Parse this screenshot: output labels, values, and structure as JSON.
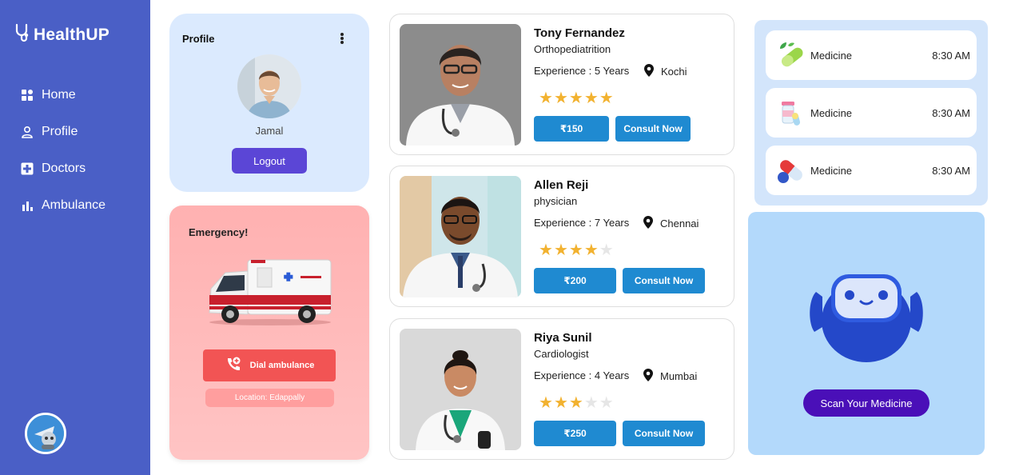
{
  "brand": {
    "name": "HealthUP",
    "icon": "stethoscope-icon"
  },
  "nav": [
    {
      "label": "Home",
      "icon": "home-grid-icon"
    },
    {
      "label": "Profile",
      "icon": "user-icon"
    },
    {
      "label": "Doctors",
      "icon": "medical-cross-icon"
    },
    {
      "label": "Ambulance",
      "icon": "bar-chart-icon"
    }
  ],
  "profile": {
    "title": "Profile",
    "name": "Jamal",
    "logout_label": "Logout"
  },
  "emergency": {
    "title": "Emergency!",
    "dial_label": "Dial ambulance",
    "location": "Location: Edappally"
  },
  "doctors": [
    {
      "name": "Tony Fernandez",
      "specialty": "Orthopediatrition",
      "experience": "Experience : 5 Years",
      "location": "Kochi",
      "rating": 5,
      "price": "₹150",
      "consult_label": "Consult Now"
    },
    {
      "name": "Allen Reji",
      "specialty": "physician",
      "experience": "Experience : 7 Years",
      "location": "Chennai",
      "rating": 4,
      "price": "₹200",
      "consult_label": "Consult Now"
    },
    {
      "name": "Riya Sunil",
      "specialty": "Cardiologist",
      "experience": "Experience : 4 Years",
      "location": "Mumbai",
      "rating": 3,
      "price": "₹250",
      "consult_label": "Consult Now"
    }
  ],
  "medicines": [
    {
      "label": "Medicine",
      "time": "8:30 AM",
      "icon": "leaf-pill-icon"
    },
    {
      "label": "Medicine",
      "time": "8:30 AM",
      "icon": "pill-bottle-icon"
    },
    {
      "label": "Medicine",
      "time": "8:30 AM",
      "icon": "capsule-icon"
    }
  ],
  "scanner": {
    "button_label": "Scan Your Medicine",
    "icon": "robot-icon"
  },
  "colors": {
    "sidebar": "#4a5fc6",
    "primary_button": "#1f8ad1",
    "logout": "#5b46d6",
    "emergency": "#f25454",
    "scan_button": "#4a0fb8",
    "star": "#f2b230"
  }
}
